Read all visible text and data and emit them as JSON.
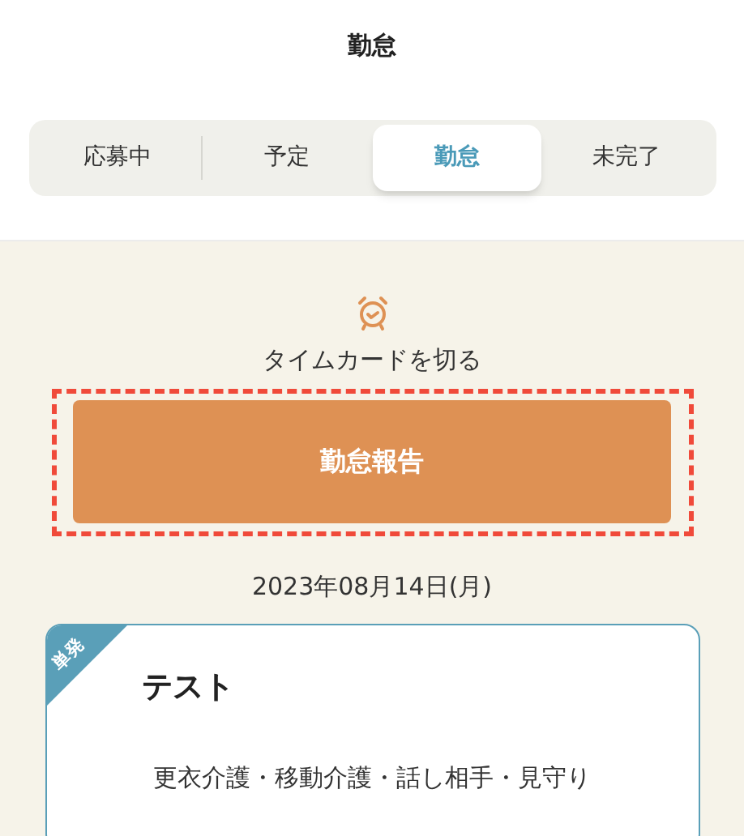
{
  "header": {
    "title": "勤怠"
  },
  "tabs": [
    {
      "label": "応募中",
      "selected": false
    },
    {
      "label": "予定",
      "selected": false
    },
    {
      "label": "勤怠",
      "selected": true
    },
    {
      "label": "未完了",
      "selected": false
    }
  ],
  "timecard": {
    "caption": "タイムカードを切る",
    "button": "勤怠報告",
    "highlighted": true
  },
  "date": "2023年08月14日(月)",
  "job": {
    "badge": "単発",
    "title": "テスト",
    "tasks": "更衣介護・移動介護・話し相手・見守り"
  }
}
